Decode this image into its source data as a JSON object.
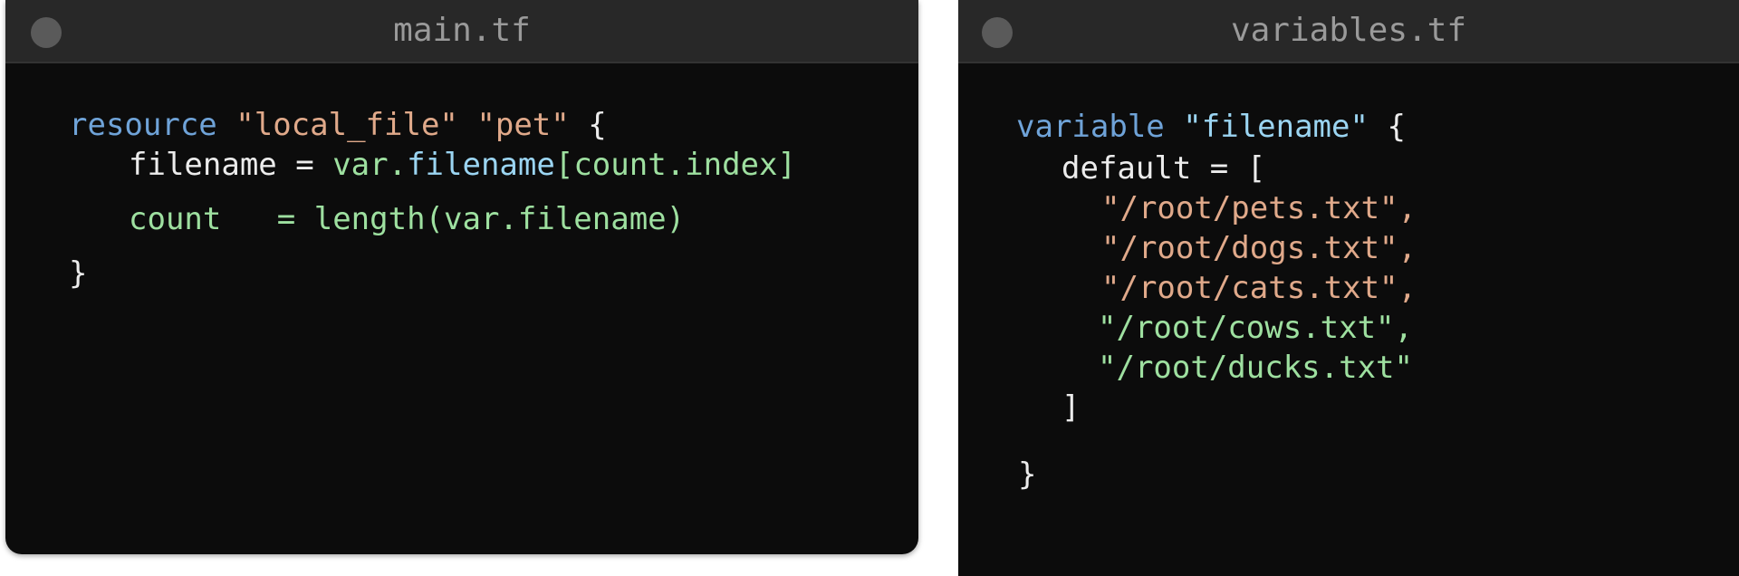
{
  "windows": {
    "main": {
      "title": "main.tf",
      "lines": {
        "l1": {
          "kw": "resource",
          "s1": "\"local_file\"",
          "s2": "\"pet\"",
          "brace": "{"
        },
        "l2": {
          "attr": "filename",
          "eq": " = ",
          "val1": "var.",
          "val2": "filename",
          "idx": "[count.index]"
        },
        "l3": {
          "attr": "count",
          "eq": "   = ",
          "val": "length(var.filename)"
        },
        "l4": {
          "brace": "}"
        }
      }
    },
    "variables": {
      "title": "variables.tf",
      "lines": {
        "l1": {
          "kw": "variable",
          "q1": "\"",
          "name": "filename",
          "q2": "\"",
          "brace": "{"
        },
        "l2": {
          "text": "default = ["
        },
        "items": [
          "\"/root/pets.txt\",",
          "\"/root/dogs.txt\",",
          "\"/root/cats.txt\",",
          "\"/root/cows.txt\",",
          "\"/root/ducks.txt\""
        ],
        "close_bracket": "]",
        "close_brace": "}"
      }
    }
  }
}
